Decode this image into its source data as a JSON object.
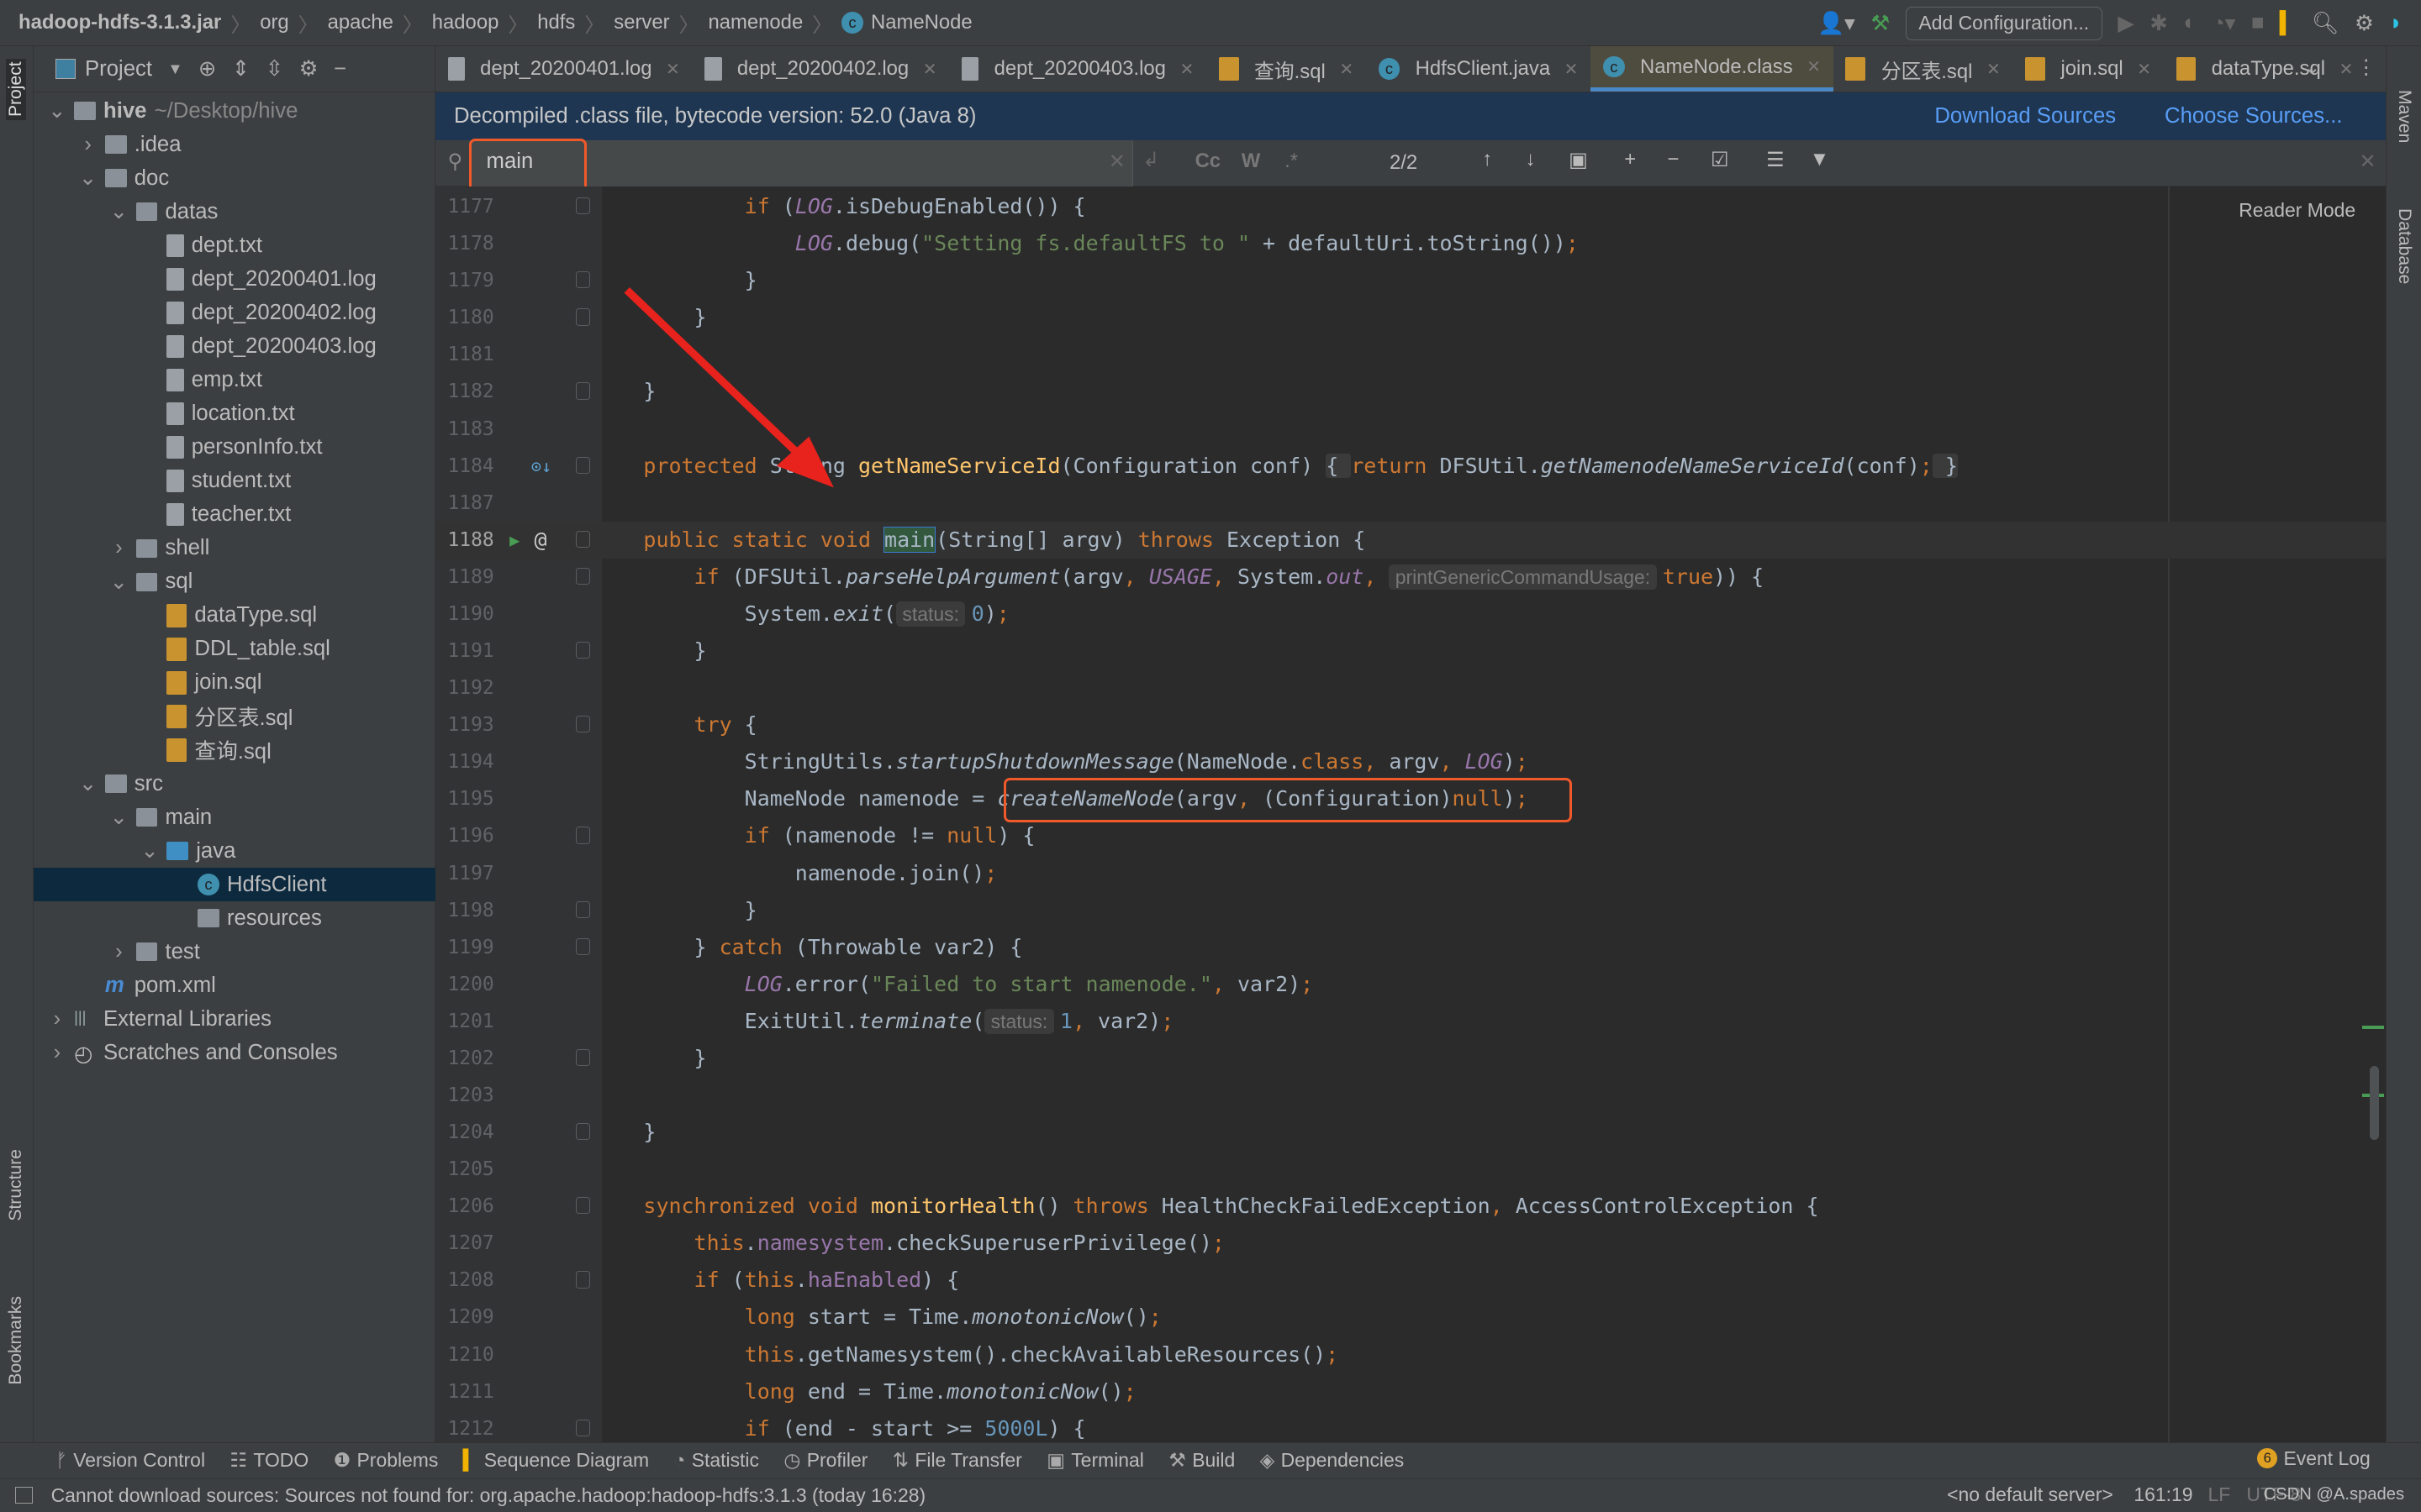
{
  "breadcrumbs": [
    "hadoop-hdfs-3.1.3.jar",
    "org",
    "apache",
    "hadoop",
    "hdfs",
    "server",
    "namenode",
    "NameNode"
  ],
  "toolbar": {
    "add_configuration": "Add Configuration..."
  },
  "left_stripe": {
    "project": "Project",
    "structure": "Structure",
    "bookmarks": "Bookmarks"
  },
  "right_stripe": {
    "maven": "Maven",
    "database": "Database"
  },
  "project_panel": {
    "title": "Project"
  },
  "tree": [
    {
      "label": "hive",
      "extra": "~/Desktop/hive",
      "level": 0,
      "arrow": "v",
      "icon": "folder",
      "bold": true
    },
    {
      "label": ".idea",
      "level": 1,
      "arrow": ">",
      "icon": "folder"
    },
    {
      "label": "doc",
      "level": 1,
      "arrow": "v",
      "icon": "folder"
    },
    {
      "label": "datas",
      "level": 2,
      "arrow": "v",
      "icon": "folder"
    },
    {
      "label": "dept.txt",
      "level": 3,
      "icon": "file"
    },
    {
      "label": "dept_20200401.log",
      "level": 3,
      "icon": "file"
    },
    {
      "label": "dept_20200402.log",
      "level": 3,
      "icon": "file"
    },
    {
      "label": "dept_20200403.log",
      "level": 3,
      "icon": "file"
    },
    {
      "label": "emp.txt",
      "level": 3,
      "icon": "file"
    },
    {
      "label": "location.txt",
      "level": 3,
      "icon": "file"
    },
    {
      "label": "personInfo.txt",
      "level": 3,
      "icon": "file"
    },
    {
      "label": "student.txt",
      "level": 3,
      "icon": "file"
    },
    {
      "label": "teacher.txt",
      "level": 3,
      "icon": "file"
    },
    {
      "label": "shell",
      "level": 2,
      "arrow": ">",
      "icon": "folder"
    },
    {
      "label": "sql",
      "level": 2,
      "arrow": "v",
      "icon": "folder"
    },
    {
      "label": "dataType.sql",
      "level": 3,
      "icon": "sql"
    },
    {
      "label": "DDL_table.sql",
      "level": 3,
      "icon": "sql"
    },
    {
      "label": "join.sql",
      "level": 3,
      "icon": "sql"
    },
    {
      "label": "分区表.sql",
      "level": 3,
      "icon": "sql"
    },
    {
      "label": "查询.sql",
      "level": 3,
      "icon": "sql"
    },
    {
      "label": "src",
      "level": 1,
      "arrow": "v",
      "icon": "folder"
    },
    {
      "label": "main",
      "level": 2,
      "arrow": "v",
      "icon": "folder"
    },
    {
      "label": "java",
      "level": 3,
      "arrow": "v",
      "icon": "folder-blue"
    },
    {
      "label": "HdfsClient",
      "level": 4,
      "icon": "class",
      "selected": true
    },
    {
      "label": "resources",
      "level": 4,
      "icon": "folder"
    },
    {
      "label": "test",
      "level": 2,
      "arrow": ">",
      "icon": "folder"
    },
    {
      "label": "pom.xml",
      "level": 1,
      "icon": "maven"
    },
    {
      "label": "External Libraries",
      "level": 0,
      "arrow": ">",
      "icon": "library"
    },
    {
      "label": "Scratches and Consoles",
      "level": 0,
      "arrow": ">",
      "icon": "scratch"
    }
  ],
  "tabs": [
    {
      "label": "dept_20200401.log",
      "icon": "file"
    },
    {
      "label": "dept_20200402.log",
      "icon": "file"
    },
    {
      "label": "dept_20200403.log",
      "icon": "file"
    },
    {
      "label": "查询.sql",
      "icon": "sql"
    },
    {
      "label": "HdfsClient.java",
      "icon": "class"
    },
    {
      "label": "NameNode.class",
      "icon": "class",
      "active": true
    },
    {
      "label": "分区表.sql",
      "icon": "sql"
    },
    {
      "label": "join.sql",
      "icon": "sql"
    },
    {
      "label": "dataType.sql",
      "icon": "sql"
    }
  ],
  "banner": {
    "text": "Decompiled .class file, bytecode version: 52.0 (Java 8)",
    "download": "Download Sources",
    "choose": "Choose Sources..."
  },
  "search": {
    "value": "main",
    "options": [
      "Cc",
      "W",
      ".*"
    ],
    "count": "2/2"
  },
  "editor": {
    "reader_mode": "Reader Mode",
    "current_line": "1188"
  },
  "code": [
    {
      "n": "1177",
      "t": [
        [
          "p",
          "            "
        ],
        [
          "k",
          "if"
        ],
        [
          "p",
          " ("
        ],
        [
          "c",
          "LOG"
        ],
        [
          "p",
          ".isDebugEnabled()) {"
        ]
      ]
    },
    {
      "n": "1178",
      "t": [
        [
          "p",
          "                "
        ],
        [
          "c",
          "LOG"
        ],
        [
          "p",
          ".debug("
        ],
        [
          "s",
          "\"Setting fs.defaultFS to \""
        ],
        [
          "p",
          " + defaultUri.toString())"
        ],
        [
          "k",
          ";"
        ]
      ]
    },
    {
      "n": "1179",
      "t": [
        [
          "p",
          "            }"
        ]
      ]
    },
    {
      "n": "1180",
      "t": [
        [
          "p",
          "        }"
        ]
      ]
    },
    {
      "n": "1181",
      "t": []
    },
    {
      "n": "1182",
      "t": [
        [
          "p",
          "    }"
        ]
      ]
    },
    {
      "n": "1183",
      "t": []
    },
    {
      "n": "1184",
      "t": [
        [
          "p",
          "    "
        ],
        [
          "k",
          "protected "
        ],
        [
          "p",
          "String "
        ],
        [
          "d",
          "getNameServiceId"
        ],
        [
          "p",
          "(Configuration conf) "
        ],
        [
          "fb",
          "{ "
        ],
        [
          "k",
          "return "
        ],
        [
          "p",
          "DFSUtil."
        ],
        [
          "i",
          "getNamenodeNameServiceId"
        ],
        [
          "p",
          "(conf)"
        ],
        [
          "k",
          ";"
        ],
        [
          "fb",
          " }"
        ]
      ]
    },
    {
      "n": "1187",
      "t": []
    },
    {
      "n": "1188",
      "t": [
        [
          "p",
          "    "
        ],
        [
          "k",
          "public static void "
        ],
        [
          "m",
          "main"
        ],
        [
          "p",
          "(String[] argv) "
        ],
        [
          "k",
          "throws "
        ],
        [
          "p",
          "Exception {"
        ]
      ]
    },
    {
      "n": "1189",
      "t": [
        [
          "p",
          "        "
        ],
        [
          "k",
          "if "
        ],
        [
          "p",
          "(DFSUtil."
        ],
        [
          "i",
          "parseHelpArgument"
        ],
        [
          "p",
          "(argv"
        ],
        [
          "k",
          ", "
        ],
        [
          "c",
          "USAGE"
        ],
        [
          "k",
          ", "
        ],
        [
          "p",
          "System."
        ],
        [
          "c",
          "out"
        ],
        [
          "k",
          ", "
        ],
        [
          "h",
          "printGenericCommandUsage:"
        ],
        [
          "k",
          "true"
        ],
        [
          "p",
          ")) {"
        ]
      ]
    },
    {
      "n": "1190",
      "t": [
        [
          "p",
          "            System."
        ],
        [
          "i",
          "exit"
        ],
        [
          "p",
          "("
        ],
        [
          "h",
          "status:"
        ],
        [
          "n",
          "0"
        ],
        [
          "p",
          ")"
        ],
        [
          "k",
          ";"
        ]
      ]
    },
    {
      "n": "1191",
      "t": [
        [
          "p",
          "        }"
        ]
      ]
    },
    {
      "n": "1192",
      "t": []
    },
    {
      "n": "1193",
      "t": [
        [
          "p",
          "        "
        ],
        [
          "k",
          "try "
        ],
        [
          "p",
          "{"
        ]
      ]
    },
    {
      "n": "1194",
      "t": [
        [
          "p",
          "            StringUtils."
        ],
        [
          "i",
          "startupShutdownMessage"
        ],
        [
          "p",
          "(NameNode."
        ],
        [
          "k",
          "class, "
        ],
        [
          "p",
          "argv"
        ],
        [
          "k",
          ", "
        ],
        [
          "c",
          "LOG"
        ],
        [
          "p",
          ")"
        ],
        [
          "k",
          ";"
        ]
      ]
    },
    {
      "n": "1195",
      "t": [
        [
          "p",
          "            NameNode namenode = "
        ],
        [
          "i",
          "createNameNode"
        ],
        [
          "p",
          "(argv"
        ],
        [
          "k",
          ", "
        ],
        [
          "p",
          "(Configuration)"
        ],
        [
          "k",
          "null"
        ],
        [
          "p",
          ")"
        ],
        [
          "k",
          ";"
        ]
      ]
    },
    {
      "n": "1196",
      "t": [
        [
          "p",
          "            "
        ],
        [
          "k",
          "if "
        ],
        [
          "p",
          "(namenode != "
        ],
        [
          "k",
          "null"
        ],
        [
          "p",
          ") {"
        ]
      ]
    },
    {
      "n": "1197",
      "t": [
        [
          "p",
          "                namenode.join()"
        ],
        [
          "k",
          ";"
        ]
      ]
    },
    {
      "n": "1198",
      "t": [
        [
          "p",
          "            }"
        ]
      ]
    },
    {
      "n": "1199",
      "t": [
        [
          "p",
          "        } "
        ],
        [
          "k",
          "catch "
        ],
        [
          "p",
          "(Throwable var2) {"
        ]
      ]
    },
    {
      "n": "1200",
      "t": [
        [
          "p",
          "            "
        ],
        [
          "c",
          "LOG"
        ],
        [
          "p",
          ".error("
        ],
        [
          "s",
          "\"Failed to start namenode.\""
        ],
        [
          "k",
          ", "
        ],
        [
          "p",
          "var2)"
        ],
        [
          "k",
          ";"
        ]
      ]
    },
    {
      "n": "1201",
      "t": [
        [
          "p",
          "            ExitUtil."
        ],
        [
          "i",
          "terminate"
        ],
        [
          "p",
          "("
        ],
        [
          "h",
          "status:"
        ],
        [
          "n",
          "1"
        ],
        [
          "k",
          ", "
        ],
        [
          "p",
          "var2)"
        ],
        [
          "k",
          ";"
        ]
      ]
    },
    {
      "n": "1202",
      "t": [
        [
          "p",
          "        }"
        ]
      ]
    },
    {
      "n": "1203",
      "t": []
    },
    {
      "n": "1204",
      "t": [
        [
          "p",
          "    }"
        ]
      ]
    },
    {
      "n": "1205",
      "t": []
    },
    {
      "n": "1206",
      "t": [
        [
          "p",
          "    "
        ],
        [
          "k",
          "synchronized void "
        ],
        [
          "d",
          "monitorHealth"
        ],
        [
          "p",
          "() "
        ],
        [
          "k",
          "throws "
        ],
        [
          "p",
          "HealthCheckFailedException"
        ],
        [
          "k",
          ", "
        ],
        [
          "p",
          "AccessControlException {"
        ]
      ]
    },
    {
      "n": "1207",
      "t": [
        [
          "p",
          "        "
        ],
        [
          "k",
          "this"
        ],
        [
          "p",
          "."
        ],
        [
          "f",
          "namesystem"
        ],
        [
          "p",
          ".checkSuperuserPrivilege()"
        ],
        [
          "k",
          ";"
        ]
      ]
    },
    {
      "n": "1208",
      "t": [
        [
          "p",
          "        "
        ],
        [
          "k",
          "if "
        ],
        [
          "p",
          "("
        ],
        [
          "k",
          "this"
        ],
        [
          "p",
          "."
        ],
        [
          "f",
          "haEnabled"
        ],
        [
          "p",
          ") {"
        ]
      ]
    },
    {
      "n": "1209",
      "t": [
        [
          "p",
          "            "
        ],
        [
          "k",
          "long "
        ],
        [
          "p",
          "start = Time."
        ],
        [
          "i",
          "monotonicNow"
        ],
        [
          "p",
          "()"
        ],
        [
          "k",
          ";"
        ]
      ]
    },
    {
      "n": "1210",
      "t": [
        [
          "p",
          "            "
        ],
        [
          "k",
          "this"
        ],
        [
          "p",
          ".getNamesystem().checkAvailableResources()"
        ],
        [
          "k",
          ";"
        ]
      ]
    },
    {
      "n": "1211",
      "t": [
        [
          "p",
          "            "
        ],
        [
          "k",
          "long "
        ],
        [
          "p",
          "end = Time."
        ],
        [
          "i",
          "monotonicNow"
        ],
        [
          "p",
          "()"
        ],
        [
          "k",
          ";"
        ]
      ]
    },
    {
      "n": "1212",
      "t": [
        [
          "p",
          "            "
        ],
        [
          "k",
          "if "
        ],
        [
          "p",
          "(end - start >= "
        ],
        [
          "n",
          "5000L"
        ],
        [
          "p",
          ") {"
        ]
      ]
    }
  ],
  "tool_windows": [
    "Version Control",
    "TODO",
    "Problems",
    "Sequence Diagram",
    "Statistic",
    "Profiler",
    "File Transfer",
    "Terminal",
    "Build",
    "Dependencies"
  ],
  "event_log": "Event Log",
  "status": {
    "message": "Cannot download sources: Sources not found for: org.apache.hadoop:hadoop-hdfs:3.1.3 (today 16:28)",
    "server": "<no default server>",
    "position": "161:19",
    "line_sep": "LF",
    "encoding": "UTF-8",
    "watermark": "CSDN @A.spades"
  },
  "colors": {
    "highlight_box": "#f0592a",
    "annotation_arrow": "#e8221c",
    "link": "#589df6",
    "banner_bg": "#1e3652"
  }
}
